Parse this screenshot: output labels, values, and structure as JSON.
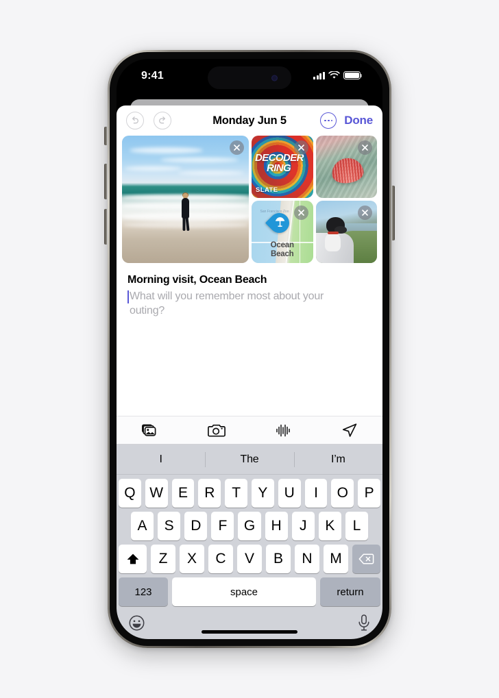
{
  "status_bar": {
    "time": "9:41",
    "cellular_icon": "signal-bars-icon",
    "wifi_icon": "wifi-icon",
    "battery_icon": "battery-icon"
  },
  "sheet": {
    "toolbar": {
      "undo_icon": "undo-icon",
      "redo_icon": "redo-icon",
      "title": "Monday Jun 5",
      "more_icon": "more-ellipsis-icon",
      "done_label": "Done"
    },
    "accent_color": "#5856d6",
    "attachments": [
      {
        "name": "beach-surfer-photo",
        "remove_label": "×"
      },
      {
        "name": "decoder-ring-podcast",
        "title_line1": "DECODER",
        "title_line2": "RING",
        "brand": "SLATE",
        "remove_label": "×"
      },
      {
        "name": "seashell-photo",
        "remove_label": "×"
      },
      {
        "name": "ocean-beach-map",
        "label_line1": "Ocean",
        "label_line2": "Beach",
        "faint_label": "San Francisco Zoo",
        "pin_icon": "beach-umbrella-icon",
        "remove_label": "×"
      },
      {
        "name": "dog-in-car-photo",
        "remove_label": "×"
      }
    ],
    "note": {
      "title": "Morning visit, Ocean Beach",
      "placeholder": "What will you remember most about your outing?"
    },
    "attach_toolbar": [
      {
        "name": "photo-library-icon",
        "label": "Photo Library"
      },
      {
        "name": "camera-icon",
        "label": "Camera"
      },
      {
        "name": "audio-waveform-icon",
        "label": "Audio"
      },
      {
        "name": "location-arrow-icon",
        "label": "Location"
      }
    ]
  },
  "keyboard": {
    "predictions": [
      "I",
      "The",
      "I’m"
    ],
    "row1": [
      "Q",
      "W",
      "E",
      "R",
      "T",
      "Y",
      "U",
      "I",
      "O",
      "P"
    ],
    "row2": [
      "A",
      "S",
      "D",
      "F",
      "G",
      "H",
      "J",
      "K",
      "L"
    ],
    "row3": [
      "Z",
      "X",
      "C",
      "V",
      "B",
      "N",
      "M"
    ],
    "shift_icon": "shift-arrow-icon",
    "delete_icon": "backspace-icon",
    "numeric_label": "123",
    "space_label": "space",
    "return_label": "return",
    "emoji_icon": "emoji-smiley-icon",
    "dictation_icon": "microphone-icon"
  }
}
